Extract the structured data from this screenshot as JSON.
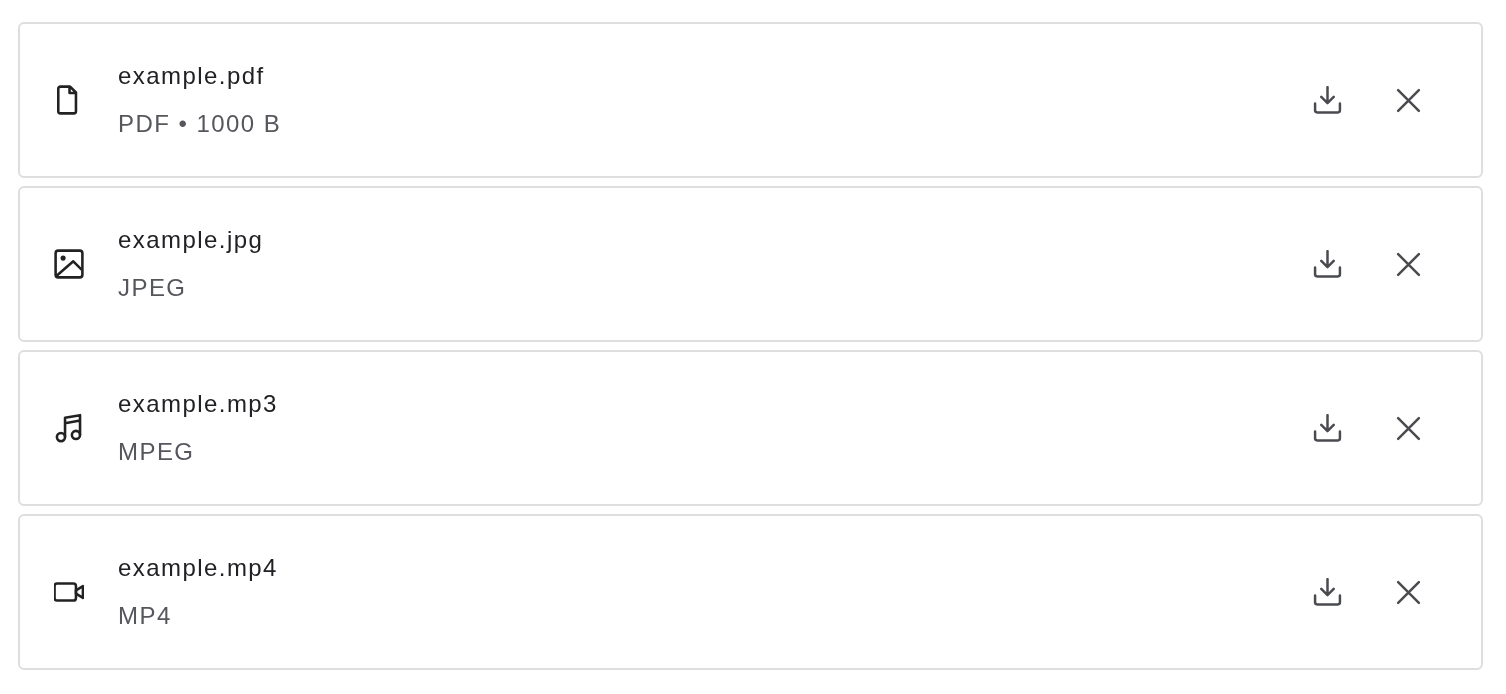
{
  "files": [
    {
      "kind": "document",
      "name": "example.pdf",
      "details": "PDF • 1000 B"
    },
    {
      "kind": "image",
      "name": "example.jpg",
      "details": "JPEG"
    },
    {
      "kind": "audio",
      "name": "example.mp3",
      "details": "MPEG"
    },
    {
      "kind": "video",
      "name": "example.mp4",
      "details": "MP4"
    }
  ]
}
